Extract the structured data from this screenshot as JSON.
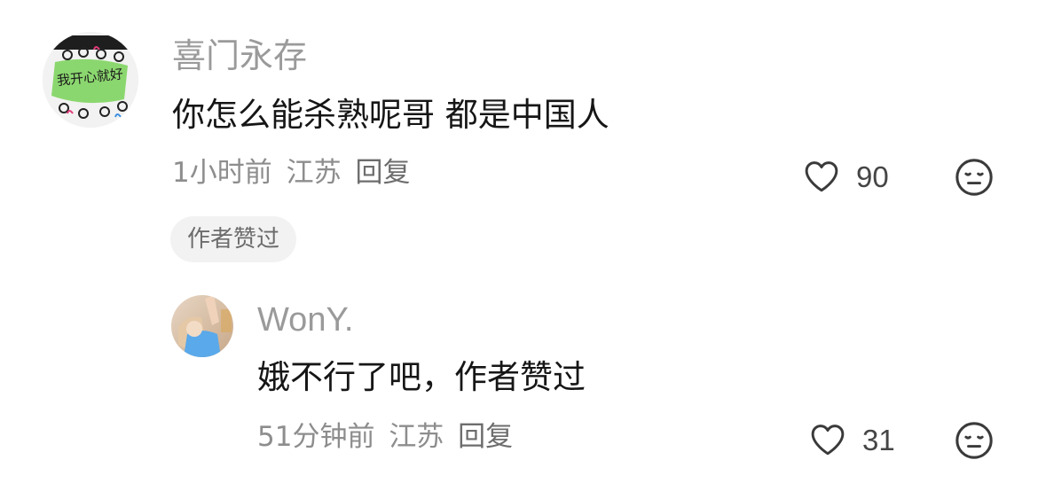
{
  "comments": [
    {
      "author": "喜门永存",
      "text": "你怎么能杀熟呢哥 都是中国人",
      "time": "1小时前",
      "location": "江苏",
      "reply_label": "回复",
      "likes": "90",
      "tag": "作者赞过",
      "avatar_text": "我开心就好"
    },
    {
      "author": "WonY.",
      "text": "娥不行了吧，作者赞过",
      "time": "51分钟前",
      "location": "江苏",
      "reply_label": "回复",
      "likes": "31"
    }
  ]
}
